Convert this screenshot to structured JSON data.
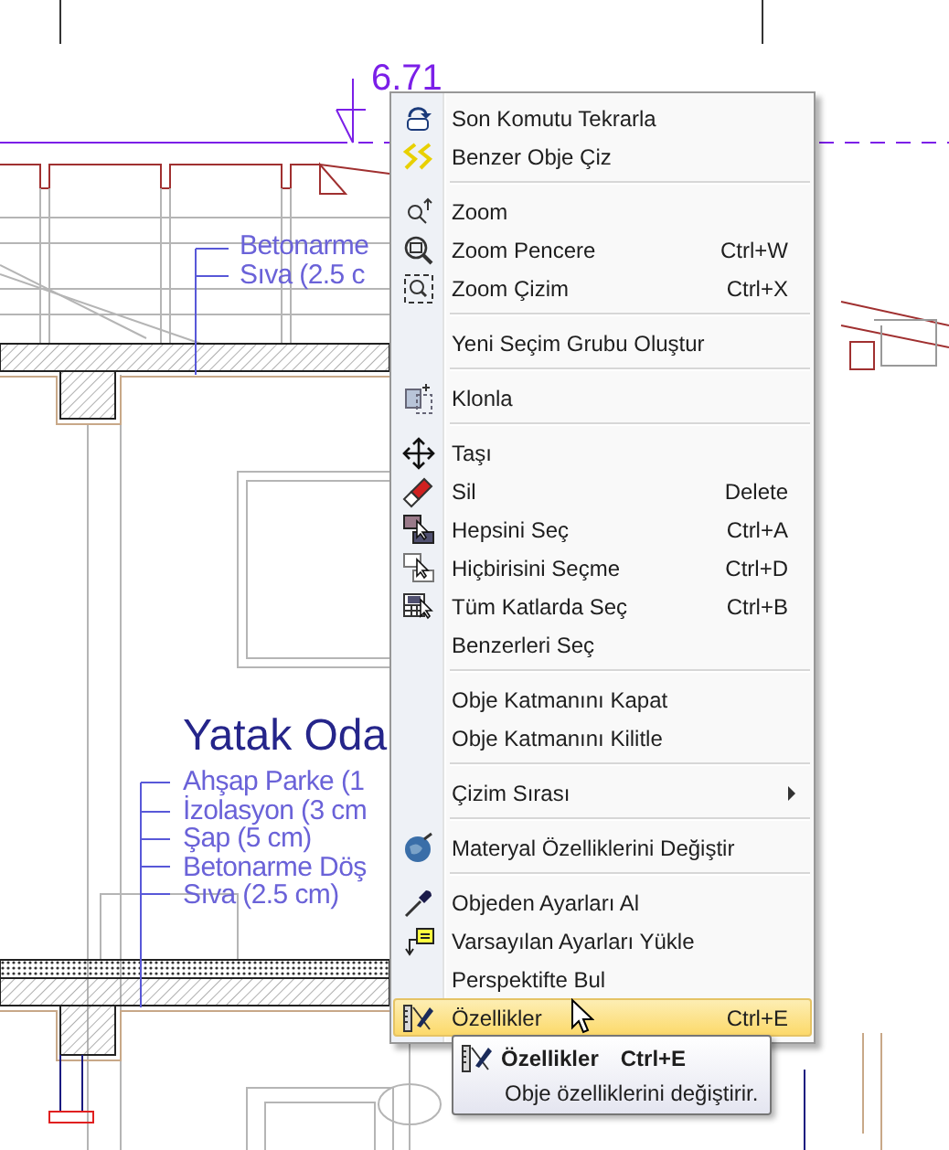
{
  "drawing": {
    "dimension": "6.71",
    "top_labels": [
      "Betonarme",
      "Sıva (2.5 c"
    ],
    "room_title": "Yatak Oda",
    "room_labels": [
      "Ahşap Parke (1",
      "İzolasyon (3 cm",
      "Şap (5 cm)",
      "Betonarme Döş",
      "Sıva (2.5 cm)"
    ]
  },
  "context_menu": {
    "items": [
      {
        "kind": "item",
        "label": "Son Komutu Tekrarla",
        "selected": false,
        "submenu": false
      },
      {
        "kind": "item",
        "label": "Benzer Obje Çiz",
        "selected": false,
        "submenu": false
      },
      {
        "kind": "separator"
      },
      {
        "kind": "item",
        "label": "Zoom",
        "selected": false,
        "submenu": false
      },
      {
        "kind": "item",
        "label": "Zoom Pencere",
        "shortcut": "Ctrl+W",
        "selected": false,
        "submenu": false
      },
      {
        "kind": "item",
        "label": "Zoom Çizim",
        "shortcut": "Ctrl+X",
        "selected": false,
        "submenu": false
      },
      {
        "kind": "separator"
      },
      {
        "kind": "item",
        "label": "Yeni Seçim Grubu Oluştur",
        "selected": false,
        "submenu": false
      },
      {
        "kind": "separator"
      },
      {
        "kind": "item",
        "label": "Klonla",
        "selected": false,
        "submenu": false
      },
      {
        "kind": "separator"
      },
      {
        "kind": "item",
        "label": "Taşı",
        "selected": false,
        "submenu": false
      },
      {
        "kind": "item",
        "label": "Sil",
        "shortcut": "Delete",
        "selected": false,
        "submenu": false
      },
      {
        "kind": "item",
        "label": "Hepsini Seç",
        "shortcut": "Ctrl+A",
        "selected": false,
        "submenu": false
      },
      {
        "kind": "item",
        "label": "Hiçbirisini Seçme",
        "shortcut": "Ctrl+D",
        "selected": false,
        "submenu": false
      },
      {
        "kind": "item",
        "label": "Tüm Katlarda Seç",
        "shortcut": "Ctrl+B",
        "selected": false,
        "submenu": false
      },
      {
        "kind": "item",
        "label": "Benzerleri Seç",
        "selected": false,
        "submenu": false
      },
      {
        "kind": "separator"
      },
      {
        "kind": "item",
        "label": "Obje Katmanını Kapat",
        "selected": false,
        "submenu": false
      },
      {
        "kind": "item",
        "label": "Obje Katmanını Kilitle",
        "selected": false,
        "submenu": false
      },
      {
        "kind": "separator"
      },
      {
        "kind": "item",
        "label": "Çizim Sırası",
        "selected": false,
        "submenu": true
      },
      {
        "kind": "separator"
      },
      {
        "kind": "item",
        "label": "Materyal Özelliklerini Değiştir",
        "selected": false,
        "submenu": false
      },
      {
        "kind": "separator"
      },
      {
        "kind": "item",
        "label": "Objeden Ayarları Al",
        "selected": false,
        "submenu": false
      },
      {
        "kind": "item",
        "label": "Varsayılan Ayarları Yükle",
        "selected": false,
        "submenu": false
      },
      {
        "kind": "item",
        "label": "Perspektifte Bul",
        "selected": false,
        "submenu": false
      },
      {
        "kind": "item",
        "label": "Özellikler",
        "shortcut": "Ctrl+E",
        "selected": true,
        "submenu": false
      }
    ]
  },
  "tooltip": {
    "title": "Özellikler",
    "shortcut": "Ctrl+E",
    "description": "Obje özelliklerini değiştirir."
  }
}
